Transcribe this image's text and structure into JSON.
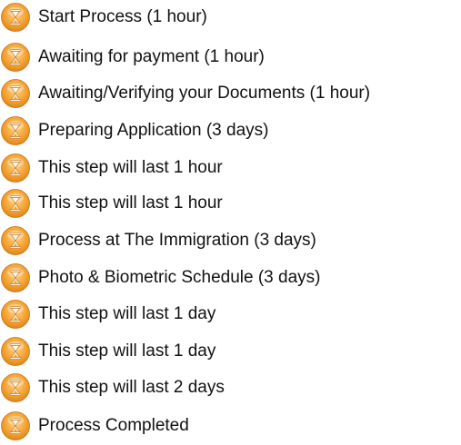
{
  "steps": [
    {
      "label": "Start Process (1 hour)",
      "icon": "hourglass-icon"
    },
    {
      "label": "Awaiting for payment (1 hour)",
      "icon": "hourglass-icon"
    },
    {
      "label": "Awaiting/Verifying your Documents (1 hour)",
      "icon": "hourglass-icon"
    },
    {
      "label": "Preparing Application (3 days)",
      "icon": "hourglass-icon"
    },
    {
      "label": "This step will last 1 hour",
      "icon": "hourglass-icon"
    },
    {
      "label": "This step will last 1 hour",
      "icon": "hourglass-icon"
    },
    {
      "label": "Process at The Immigration (3 days)",
      "icon": "hourglass-icon"
    },
    {
      "label": "Photo & Biometric Schedule (3 days)",
      "icon": "hourglass-icon"
    },
    {
      "label": "This step will last 1 day",
      "icon": "hourglass-icon"
    },
    {
      "label": "This step will last 1 day",
      "icon": "hourglass-icon"
    },
    {
      "label": "This step will last 2 days",
      "icon": "hourglass-icon"
    },
    {
      "label": "Process Completed",
      "icon": "hourglass-icon"
    }
  ],
  "colors": {
    "icon_outer": "#f0a030",
    "icon_inner": "#fbd38a",
    "text": "#111111"
  }
}
